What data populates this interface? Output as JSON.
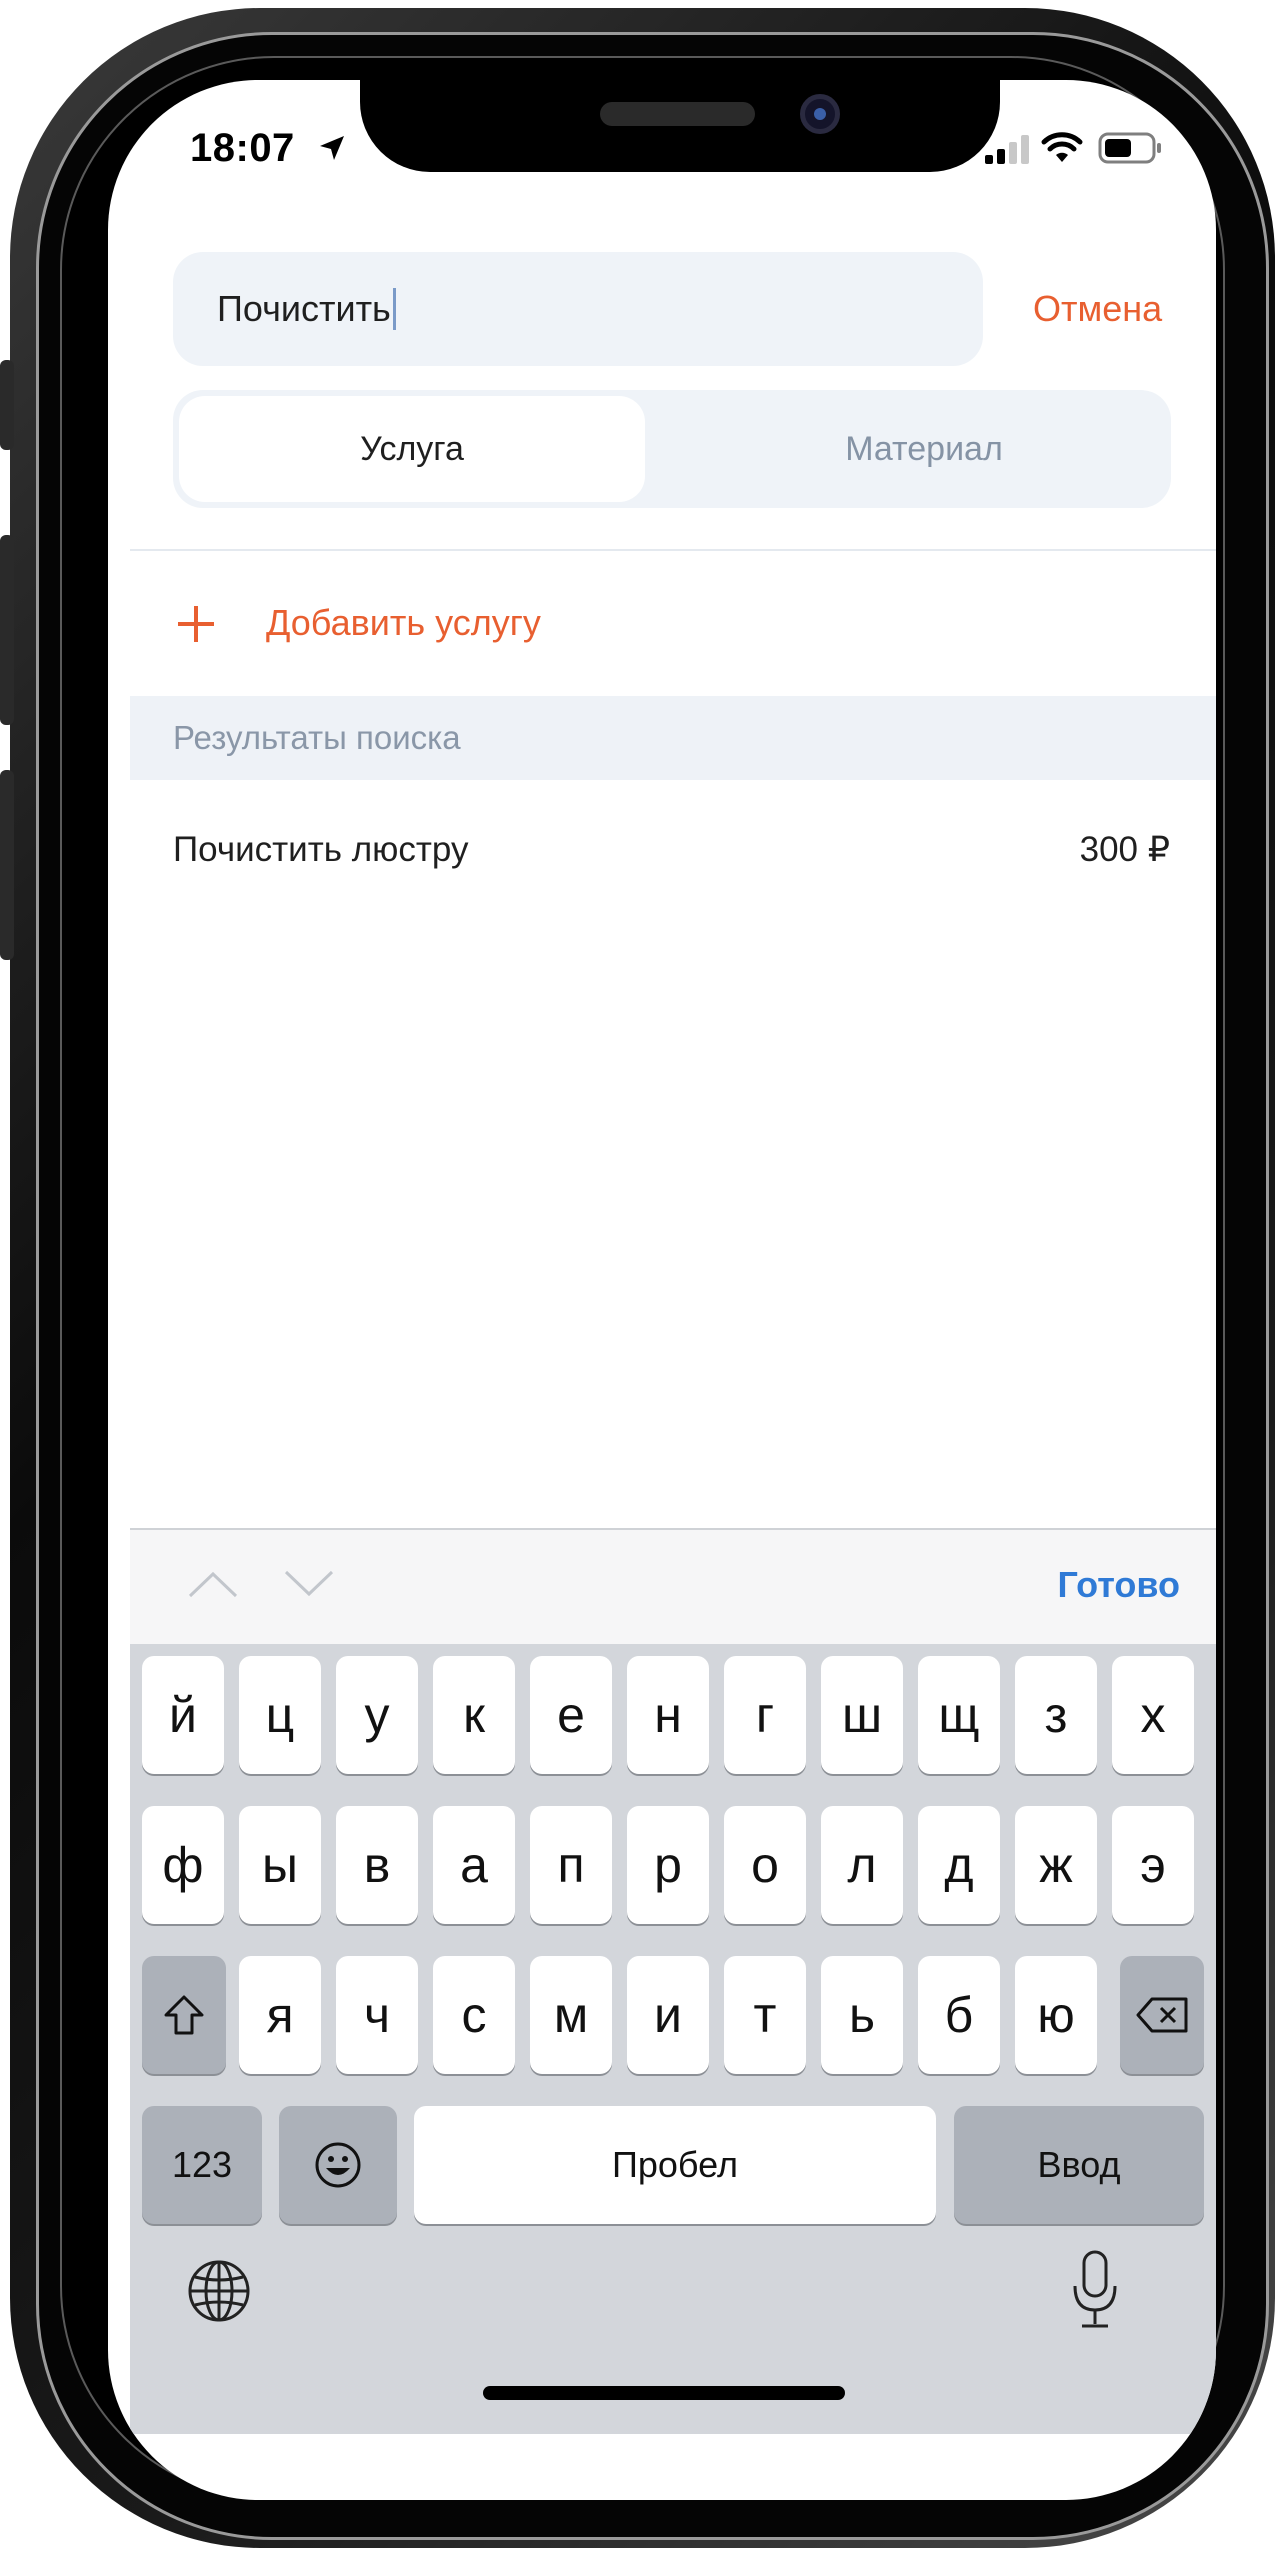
{
  "status_bar": {
    "time": "18:07"
  },
  "search": {
    "value": "Почистить",
    "cancel_label": "Отмена"
  },
  "segments": [
    {
      "label": "Услуга",
      "active": true
    },
    {
      "label": "Материал",
      "active": false
    }
  ],
  "add_service": {
    "label": "Добавить услугу"
  },
  "results": {
    "header": "Результаты поиска",
    "items": [
      {
        "name": "Почистить люстру",
        "price": "300 ₽"
      }
    ]
  },
  "keyboard_toolbar": {
    "done_label": "Готово"
  },
  "keyboard": {
    "row1": [
      "й",
      "ц",
      "у",
      "к",
      "е",
      "н",
      "г",
      "ш",
      "щ",
      "з",
      "х"
    ],
    "row2": [
      "ф",
      "ы",
      "в",
      "а",
      "п",
      "р",
      "о",
      "л",
      "д",
      "ж",
      "э"
    ],
    "row3": [
      "я",
      "ч",
      "с",
      "м",
      "и",
      "т",
      "ь",
      "б",
      "ю"
    ],
    "numbers_label": "123",
    "space_label": "Пробел",
    "return_label": "Ввод"
  },
  "colors": {
    "accent": "#e85f30",
    "link": "#2f7ad6",
    "field_bg": "#eff3f8"
  }
}
